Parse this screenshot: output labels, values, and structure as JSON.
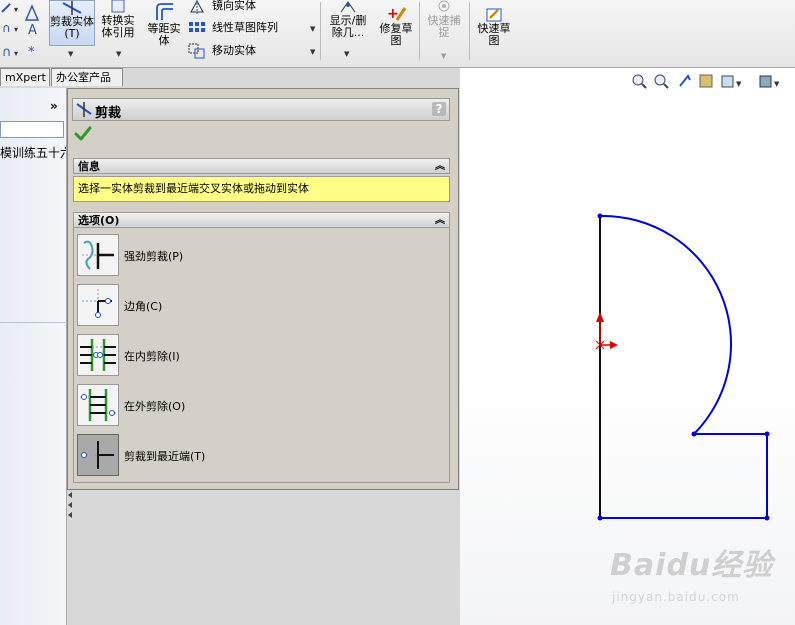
{
  "toolbar": {
    "trim_entities": "剪裁实体(T)",
    "convert_entities": "转换实体引用",
    "offset_entities": "等距实体",
    "mirror_entities": "镜向实体",
    "linear_pattern": "线性草图阵列",
    "move_entities": "移动实体",
    "display_delete_relations": "显示/删除几...",
    "repair_sketch": "修复草图",
    "quick_snaps": "快速捕捉",
    "rapid_sketch": "快速草图"
  },
  "tabs": {
    "tab1": "mXpert",
    "tab2": "办公室产品"
  },
  "feature_tree": {
    "item_text": "模训练五十六"
  },
  "property_manager": {
    "title": "剪裁",
    "help": "?",
    "info_section": "信息",
    "info_message": "选择一实体剪裁到最近端交叉实体或拖动到实体",
    "options_section": "选项(O)",
    "options": [
      {
        "label": "强劲剪裁(P)"
      },
      {
        "label": "边角(C)"
      },
      {
        "label": "在内剪除(I)"
      },
      {
        "label": "在外剪除(O)"
      },
      {
        "label": "剪裁到最近端(T)"
      }
    ]
  },
  "watermark": {
    "brand": "Baidu经验",
    "url": "jingyan.baidu.com"
  },
  "colors": {
    "sketch_line": "#0000dd",
    "accent_red": "#dd0000",
    "info_bg": "#ffff88"
  }
}
